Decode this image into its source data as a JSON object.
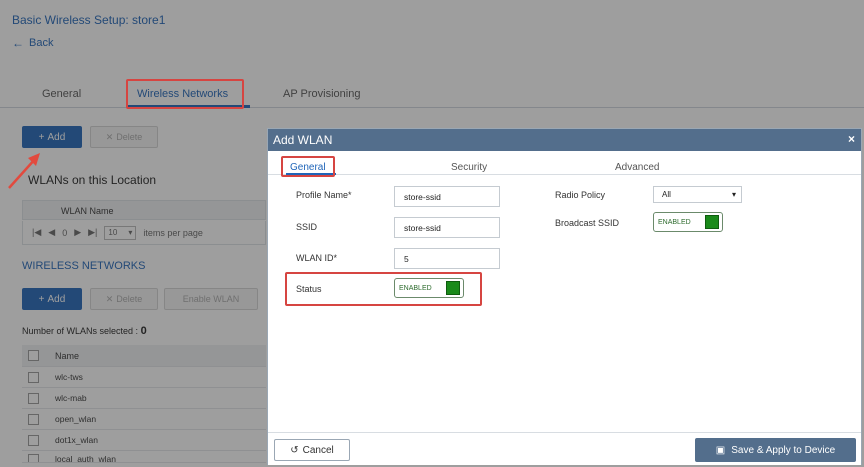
{
  "page": {
    "title": "Basic Wireless Setup: store1",
    "back_label": "Back"
  },
  "tabs": [
    {
      "label": "General"
    },
    {
      "label": "Wireless Networks"
    },
    {
      "label": "AP Provisioning"
    }
  ],
  "location_section": {
    "add_label": "Add",
    "delete_label": "Delete",
    "heading": "WLANs on this Location",
    "column_header": "WLAN Name",
    "pager": {
      "page": "0",
      "page_size": "10",
      "items_per_page_label": "items per page"
    }
  },
  "wireless_section": {
    "heading": "WIRELESS NETWORKS",
    "add_label": "Add",
    "delete_label": "Delete",
    "enable_label": "Enable WLAN",
    "count_label": "Number of WLANs selected :",
    "count_value": "0",
    "name_header": "Name",
    "rows": [
      "wlc-tws",
      "wlc-mab",
      "open_wlan",
      "dot1x_wlan",
      "local_auth_wlan"
    ]
  },
  "modal": {
    "title": "Add WLAN",
    "close": "×",
    "tabs": [
      "General",
      "Security",
      "Advanced"
    ],
    "fields": {
      "profile_name_label": "Profile Name*",
      "profile_name_value": "store-ssid",
      "ssid_label": "SSID",
      "ssid_value": "store-ssid",
      "wlan_id_label": "WLAN ID*",
      "wlan_id_value": "5",
      "status_label": "Status",
      "status_value": "ENABLED",
      "radio_policy_label": "Radio Policy",
      "radio_policy_value": "All",
      "broadcast_ssid_label": "Broadcast SSID",
      "broadcast_ssid_value": "ENABLED"
    },
    "cancel_label": "Cancel",
    "save_label": "Save & Apply to Device"
  },
  "colors": {
    "accent": "#1f64b8",
    "modal_header": "#536e8c",
    "toggle_on": "#1a8a1a",
    "highlight": "#d64541"
  },
  "icons": [
    "back-arrow-icon",
    "plus-icon",
    "x-icon",
    "first-page-icon",
    "prev-page-icon",
    "next-page-icon",
    "last-page-icon",
    "chevron-down-icon",
    "close-icon",
    "undo-icon",
    "save-icon",
    "red-arrow-icon"
  ]
}
